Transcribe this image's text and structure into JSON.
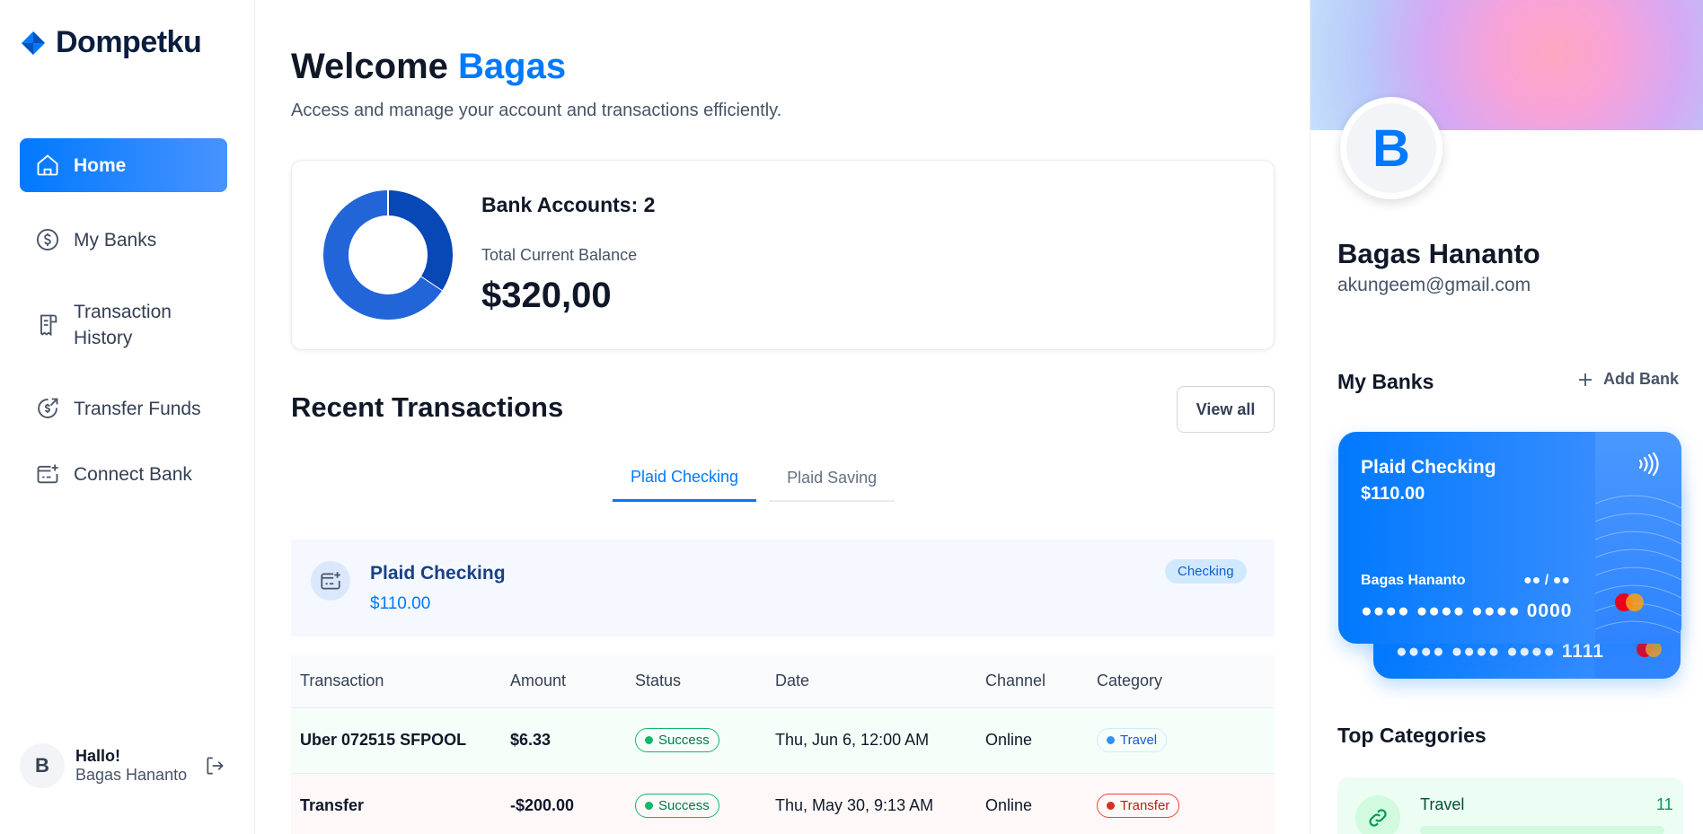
{
  "brand": {
    "name": "Dompetku"
  },
  "sidebar": {
    "items": [
      {
        "label": "Home",
        "icon": "home-icon",
        "active": true
      },
      {
        "label": "My Banks",
        "icon": "dollar-circle-icon"
      },
      {
        "label": "Transaction History",
        "icon": "receipt-icon"
      },
      {
        "label": "Transfer Funds",
        "icon": "money-send-icon"
      },
      {
        "label": "Connect Bank",
        "icon": "connect-bank-icon"
      }
    ],
    "footer": {
      "initial": "B",
      "greeting": "Hallo!",
      "name": "Bagas Hananto",
      "icon": "logout-icon"
    }
  },
  "header": {
    "welcome": "Welcome",
    "user_first_name": "Bagas",
    "subtitle": "Access and manage your account and transactions efficiently."
  },
  "summary": {
    "bank_accounts_label": "Bank Accounts: 2",
    "total_balance_label": "Total Current Balance",
    "total_balance": "$320,00",
    "donut": {
      "segments": [
        110,
        210
      ],
      "colors": [
        "#0747b6",
        "#2265d8"
      ]
    }
  },
  "recent": {
    "title": "Recent Transactions",
    "view_all": "View all",
    "tabs": [
      {
        "label": "Plaid Checking",
        "active": true
      },
      {
        "label": "Plaid Saving",
        "active": false
      }
    ],
    "account": {
      "name": "Plaid Checking",
      "balance": "$110.00",
      "badge": "Checking",
      "icon": "connect-bank-icon"
    },
    "columns": [
      "Transaction",
      "Amount",
      "Status",
      "Date",
      "Channel",
      "Category"
    ],
    "rows": [
      {
        "name": "Uber 072515 SFPOOL",
        "amount": "$6.33",
        "status": "Success",
        "date": "Thu, Jun 6, 12:00 AM",
        "channel": "Online",
        "category": "Travel",
        "type": "credit"
      },
      {
        "name": "Transfer",
        "amount": "-$200.00",
        "status": "Success",
        "date": "Thu, May 30, 9:13 AM",
        "channel": "Online",
        "category": "Transfer",
        "type": "debit"
      }
    ]
  },
  "profile": {
    "initial": "B",
    "name": "Bagas Hananto",
    "email": "akungeem@gmail.com"
  },
  "my_banks": {
    "title": "My Banks",
    "add_label": "Add Bank",
    "cards": [
      {
        "name": "Plaid Checking",
        "balance": "$110.00",
        "holder": "Bagas Hananto",
        "expiry": "●● / ●●",
        "number": "●●●● ●●●● ●●●● 0000"
      },
      {
        "number": "●●●● ●●●● ●●●● 1111"
      }
    ]
  },
  "top_categories": {
    "title": "Top Categories",
    "items": [
      {
        "name": "Travel",
        "count": "11",
        "icon": "travel-link-icon"
      }
    ]
  },
  "colors": {
    "accent": "#0179fe",
    "success": "#12b76a",
    "danger": "#f04438"
  }
}
